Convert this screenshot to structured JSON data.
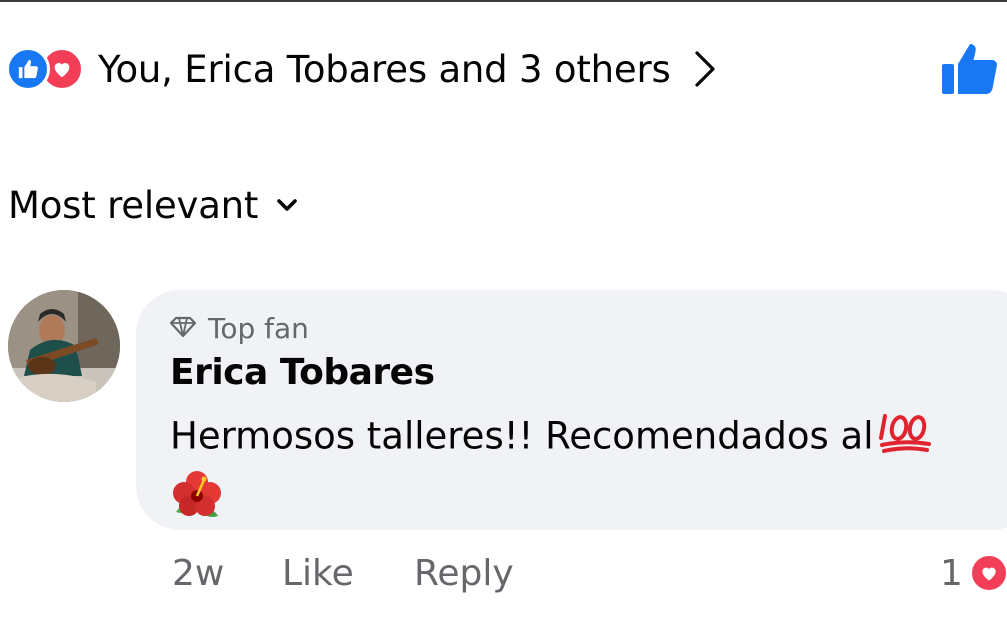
{
  "reactions": {
    "summary_text": "You, Erica Tobares and 3 others",
    "icons": [
      "like-reaction-icon",
      "love-reaction-icon"
    ]
  },
  "sort": {
    "label": "Most relevant"
  },
  "comment": {
    "badge": "Top fan",
    "author": "Erica Tobares",
    "text": "Hermosos talleres!! Recomendados al",
    "time": "2w",
    "like_label": "Like",
    "reply_label": "Reply",
    "reaction_count": "1"
  },
  "colors": {
    "like_blue": "#1877f2",
    "love_red": "#f33e58",
    "bubble_bg": "#f0f2f5",
    "secondary_text": "#65676b"
  }
}
